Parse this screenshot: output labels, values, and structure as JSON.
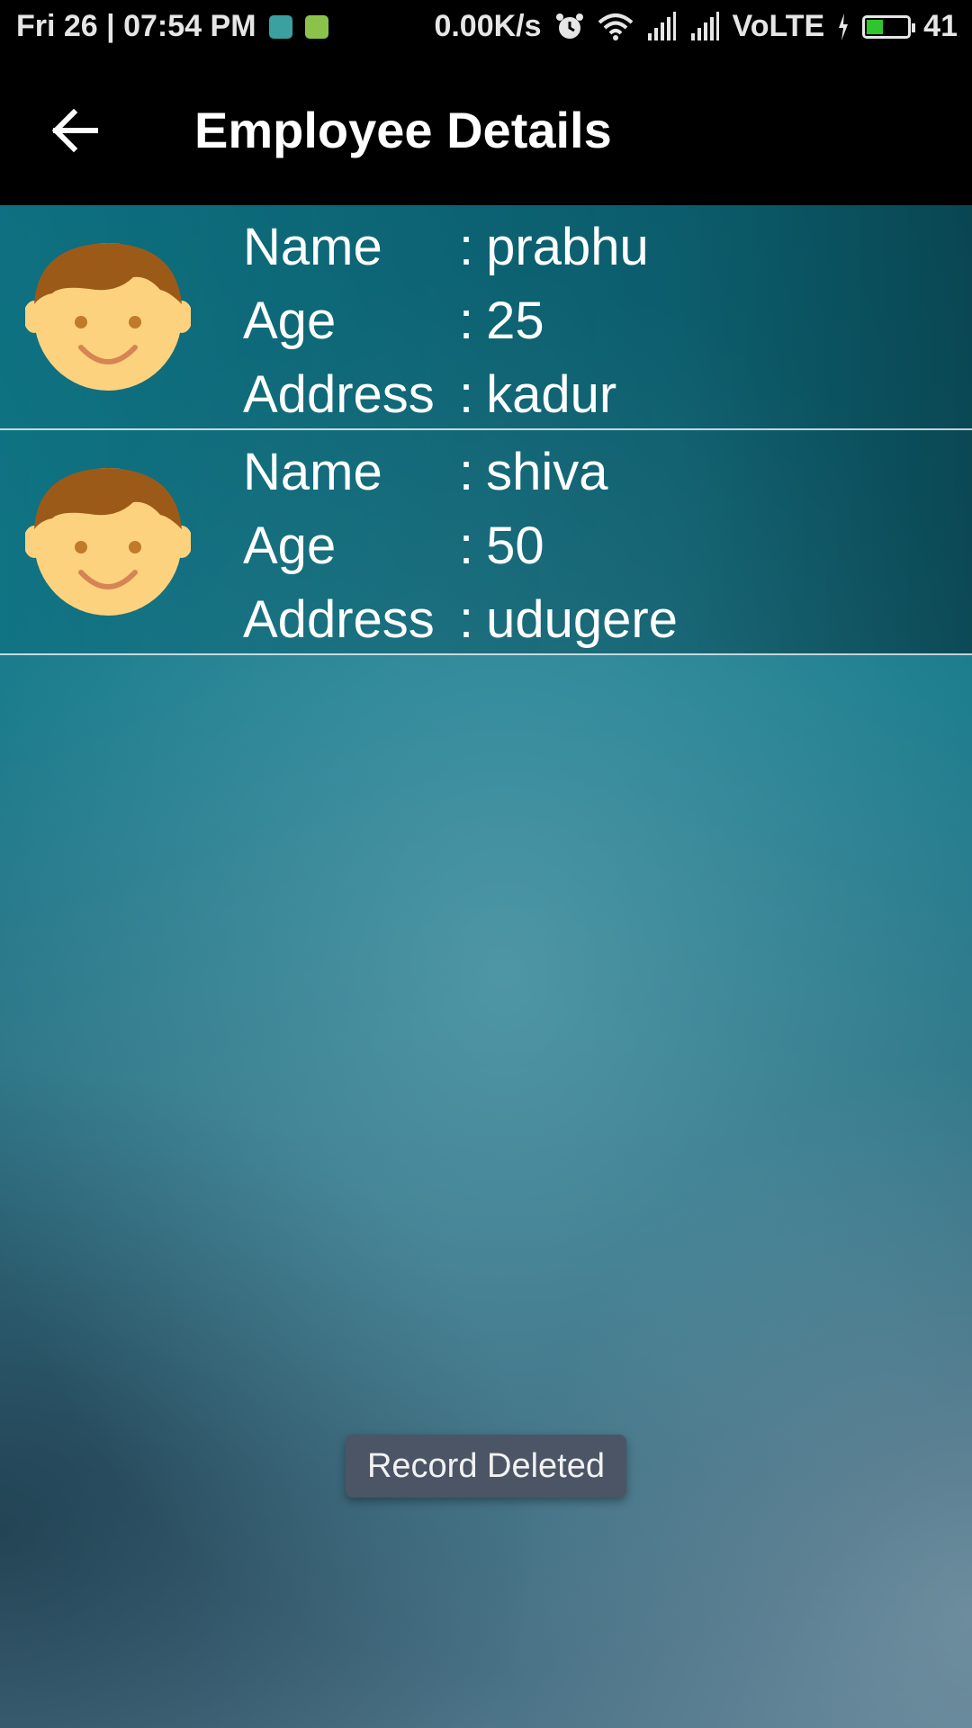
{
  "status_bar": {
    "datetime": "Fri 26 | 07:54 PM",
    "net_speed": "0.00K/s",
    "network_type": "VoLTE",
    "battery_level": "41",
    "battery_fraction": 0.41,
    "battery_color": "#2ec52e"
  },
  "app_bar": {
    "title": "Employee Details",
    "back_icon": "arrow-back-icon"
  },
  "employees": [
    {
      "avatar_icon": "boy-face-icon",
      "name_label": "Name",
      "name_sep": ":",
      "name_value": "prabhu",
      "age_label": "Age",
      "age_sep": ":",
      "age_value": "25",
      "address_label": "Address",
      "address_sep": ":",
      "address_value": "kadur"
    },
    {
      "avatar_icon": "boy-face-icon",
      "name_label": "Name",
      "name_sep": ":",
      "name_value": "shiva",
      "age_label": "Age",
      "age_sep": ":",
      "age_value": "50",
      "address_label": "Address",
      "address_sep": ":",
      "address_value": "udugere"
    }
  ],
  "toast": {
    "message": "Record Deleted"
  },
  "colors": {
    "app_bar_bg": "#000000",
    "toast_bg": "#4b5566",
    "avatar_hair": "#9c5a18",
    "avatar_skin": "#fdd27e"
  }
}
